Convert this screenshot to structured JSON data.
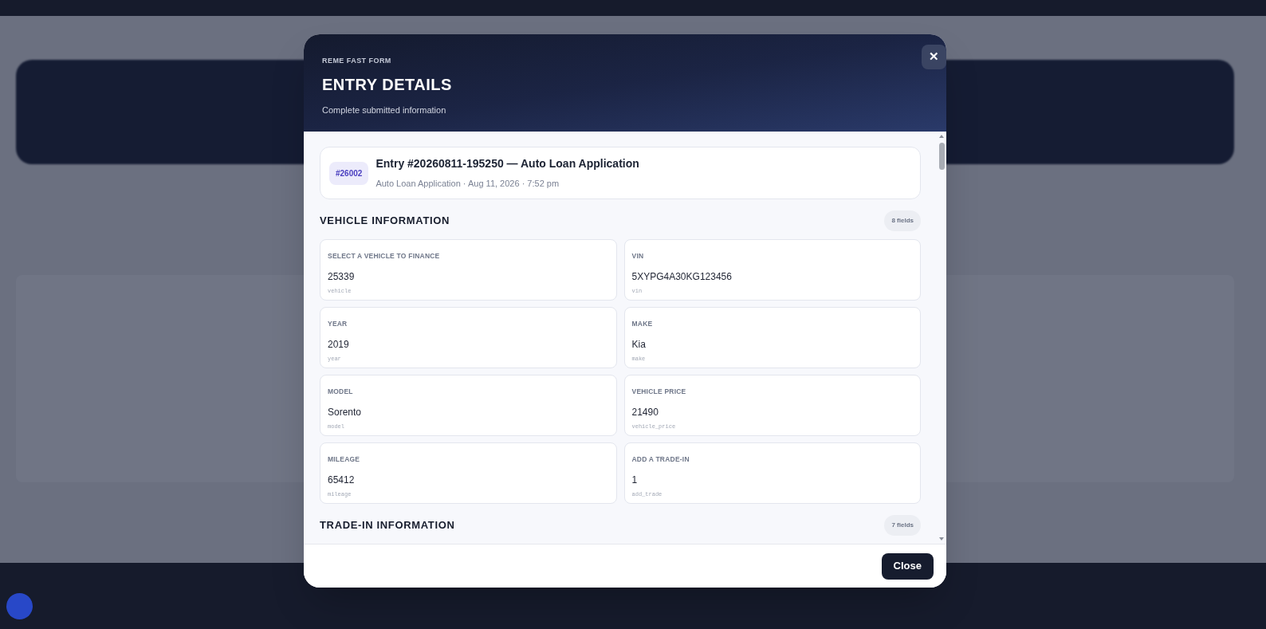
{
  "modal": {
    "eyebrow": "REME FAST FORM",
    "title": "ENTRY DETAILS",
    "subtitle": "Complete submitted information",
    "close_icon": "✕",
    "entry": {
      "badge": "#26002",
      "title": "Entry #20260811-195250 — Auto Loan Application",
      "meta": "Auto Loan Application · Aug 11, 2026 · 7:52 pm"
    },
    "sections": [
      {
        "title": "VEHICLE INFORMATION",
        "count": "8 fields",
        "fields": [
          {
            "label": "SELECT A VEHICLE TO FINANCE",
            "value": "25339",
            "key": "vehicle"
          },
          {
            "label": "VIN",
            "value": "5XYPG4A30KG123456",
            "key": "vin"
          },
          {
            "label": "YEAR",
            "value": "2019",
            "key": "year"
          },
          {
            "label": "MAKE",
            "value": "Kia",
            "key": "make"
          },
          {
            "label": "MODEL",
            "value": "Sorento",
            "key": "model"
          },
          {
            "label": "VEHICLE PRICE",
            "value": "21490",
            "key": "vehicle_price"
          },
          {
            "label": "MILEAGE",
            "value": "65412",
            "key": "mileage"
          },
          {
            "label": "ADD A TRADE-IN",
            "value": "1",
            "key": "add_trade"
          }
        ]
      },
      {
        "title": "TRADE-IN INFORMATION",
        "count": "7 fields"
      }
    ],
    "footer_button": "Close"
  }
}
